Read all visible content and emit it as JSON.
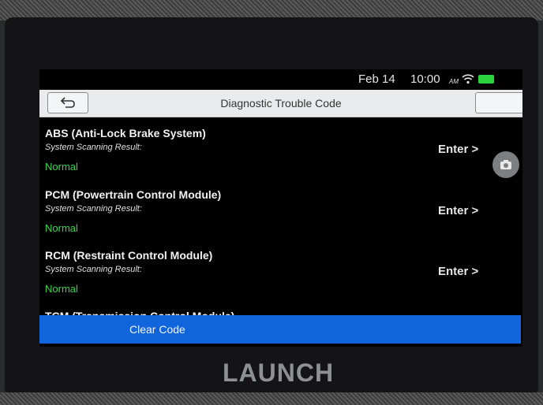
{
  "status": {
    "date": "Feb 14",
    "time": "10:00",
    "ampm": "AM"
  },
  "header": {
    "title": "Diagnostic Trouble Code"
  },
  "systems": [
    {
      "name": "ABS (Anti-Lock Brake System)",
      "result_label": "System Scanning Result:",
      "result": "Normal",
      "action": "Enter >"
    },
    {
      "name": "PCM (Powertrain Control Module)",
      "result_label": "System Scanning Result:",
      "result": "Normal",
      "action": "Enter >"
    },
    {
      "name": "RCM (Restraint Control Module)",
      "result_label": "System Scanning Result:",
      "result": "Normal",
      "action": "Enter >"
    },
    {
      "name": "TCM (Transmission Control Module)"
    }
  ],
  "actions": {
    "clear_code": "Clear Code"
  },
  "device": {
    "brand": "LAUNCH"
  },
  "colors": {
    "normal_status": "#37d64a",
    "primary_button": "#1064dc",
    "title_bar": "#e9ebec"
  },
  "icons": {
    "back": "back-arrow-icon",
    "wifi": "wifi-icon",
    "battery": "battery-icon",
    "camera": "camera-icon"
  }
}
